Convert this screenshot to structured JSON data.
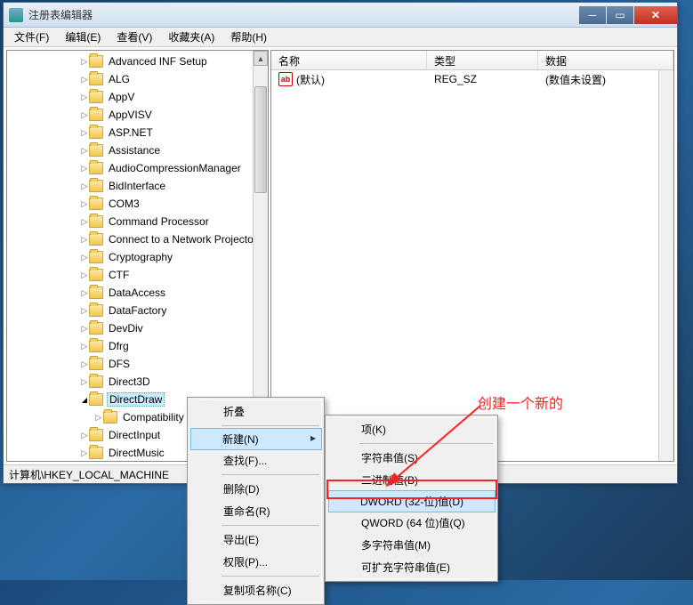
{
  "window": {
    "title": "注册表编辑器"
  },
  "menubar": {
    "file": "文件(F)",
    "edit": "编辑(E)",
    "view": "查看(V)",
    "fav": "收藏夹(A)",
    "help": "帮助(H)"
  },
  "tree": {
    "items": [
      {
        "label": "Advanced INF Setup",
        "arrow": true
      },
      {
        "label": "ALG",
        "arrow": true
      },
      {
        "label": "AppV",
        "arrow": true
      },
      {
        "label": "AppVISV",
        "arrow": true
      },
      {
        "label": "ASP.NET",
        "arrow": true
      },
      {
        "label": "Assistance",
        "arrow": true
      },
      {
        "label": "AudioCompressionManager",
        "arrow": true
      },
      {
        "label": "BidInterface",
        "arrow": true
      },
      {
        "label": "COM3",
        "arrow": true
      },
      {
        "label": "Command Processor",
        "arrow": true
      },
      {
        "label": "Connect to a Network Projector",
        "arrow": true
      },
      {
        "label": "Cryptography",
        "arrow": true
      },
      {
        "label": "CTF",
        "arrow": true
      },
      {
        "label": "DataAccess",
        "arrow": true
      },
      {
        "label": "DataFactory",
        "arrow": true
      },
      {
        "label": "DevDiv",
        "arrow": true
      },
      {
        "label": "Dfrg",
        "arrow": true
      },
      {
        "label": "DFS",
        "arrow": true
      },
      {
        "label": "Direct3D",
        "arrow": true
      },
      {
        "label": "DirectDraw",
        "arrow": true,
        "open": true,
        "selected": true
      },
      {
        "label": "Compatibility",
        "arrow": true,
        "child": true
      },
      {
        "label": "DirectInput",
        "arrow": true
      },
      {
        "label": "DirectMusic",
        "arrow": true
      }
    ]
  },
  "list": {
    "cols": {
      "name": "名称",
      "type": "类型",
      "data": "数据"
    },
    "rows": [
      {
        "name": "(默认)",
        "type": "REG_SZ",
        "data": "(数值未设置)"
      }
    ]
  },
  "statusbar": {
    "path": "计算机\\HKEY_LOCAL_MACHINE"
  },
  "ctx1": {
    "collapse": "折叠",
    "new": "新建(N)",
    "find": "查找(F)...",
    "delete": "删除(D)",
    "rename": "重命名(R)",
    "export": "导出(E)",
    "perm": "权限(P)...",
    "copyname": "复制项名称(C)"
  },
  "ctx2": {
    "key": "项(K)",
    "string": "字符串值(S)",
    "binary": "二进制值(B)",
    "dword": "DWORD (32-位)值(D)",
    "qword": "QWORD (64 位)值(Q)",
    "multi": "多字符串值(M)",
    "expand": "可扩充字符串值(E)"
  },
  "annotation": {
    "text": "创建一个新的"
  }
}
